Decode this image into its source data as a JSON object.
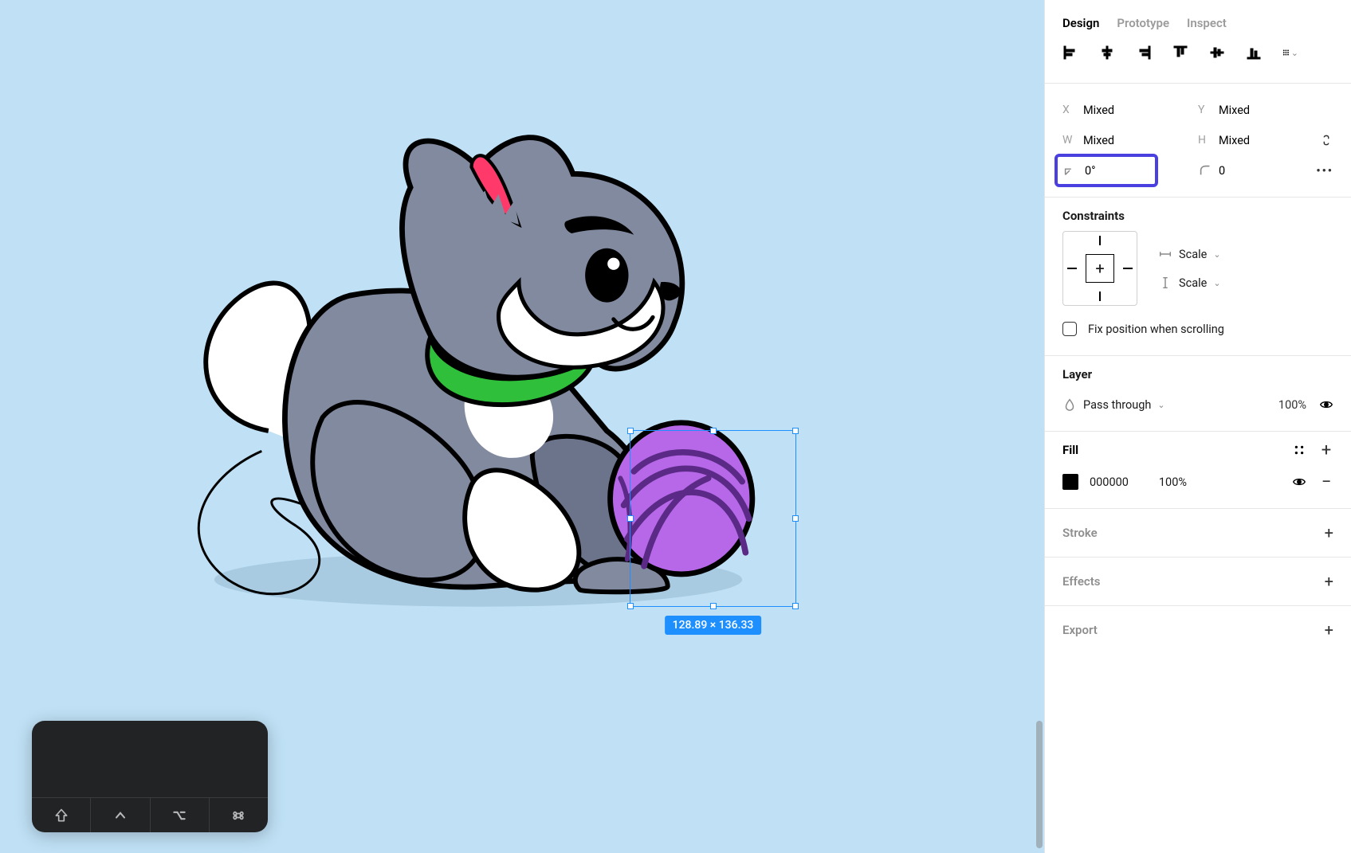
{
  "tabs": {
    "design": "Design",
    "prototype": "Prototype",
    "inspect": "Inspect"
  },
  "transform": {
    "x_label": "X",
    "x_value": "Mixed",
    "y_label": "Y",
    "y_value": "Mixed",
    "w_label": "W",
    "w_value": "Mixed",
    "h_label": "H",
    "h_value": "Mixed",
    "rotation": "0°",
    "corner_radius": "0"
  },
  "selection": {
    "size_label": "128.89 × 136.33"
  },
  "constraints": {
    "title": "Constraints",
    "horizontal": "Scale",
    "vertical": "Scale",
    "fix_label": "Fix position when scrolling"
  },
  "layer": {
    "title": "Layer",
    "blend": "Pass through",
    "opacity": "100%"
  },
  "fill": {
    "title": "Fill",
    "hex": "000000",
    "opacity": "100%"
  },
  "sections": {
    "stroke": "Stroke",
    "effects": "Effects",
    "export": "Export"
  }
}
